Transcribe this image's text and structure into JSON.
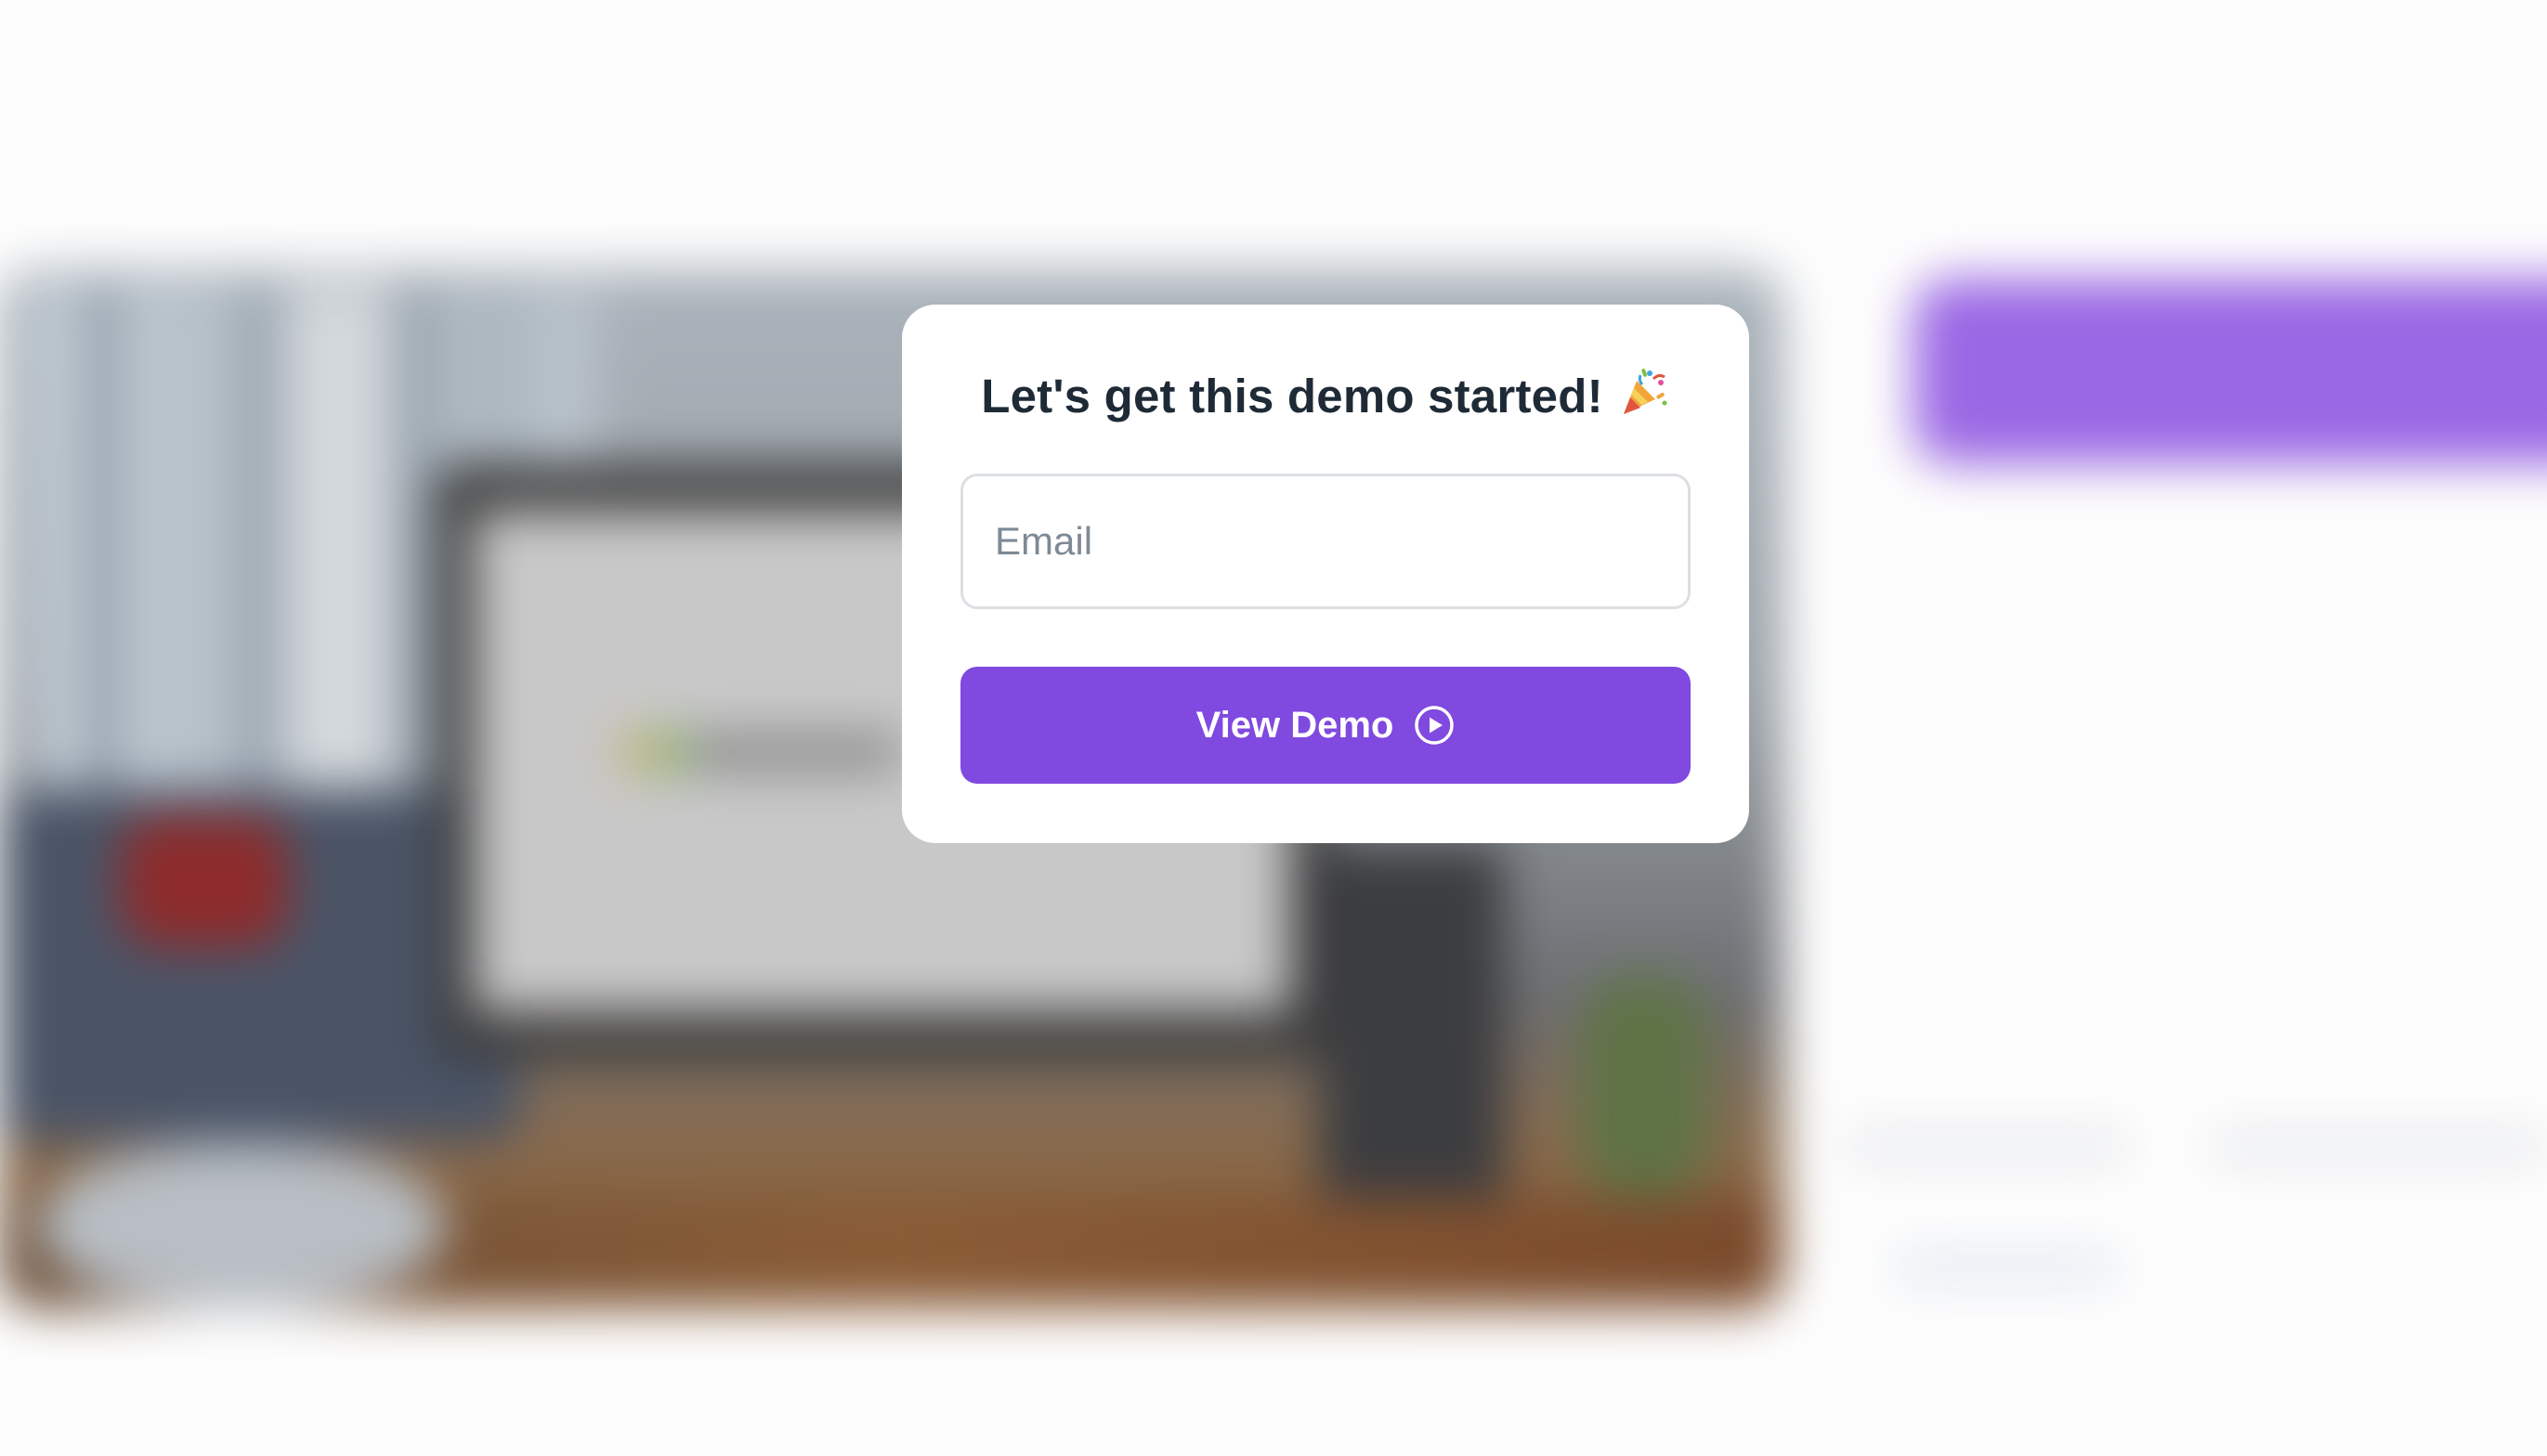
{
  "modal": {
    "title": "Let's get this demo started!",
    "title_icon": "party-popper-icon",
    "email": {
      "value": "",
      "placeholder": "Email"
    },
    "submit": {
      "label": "View Demo",
      "icon": "play-circle-icon"
    }
  },
  "colors": {
    "accent": "#8049df",
    "title_text": "#1e2a36",
    "placeholder_text": "#7e8a95",
    "input_border": "#dcdfe3",
    "background_cta_blurred": "#9a68e4"
  }
}
